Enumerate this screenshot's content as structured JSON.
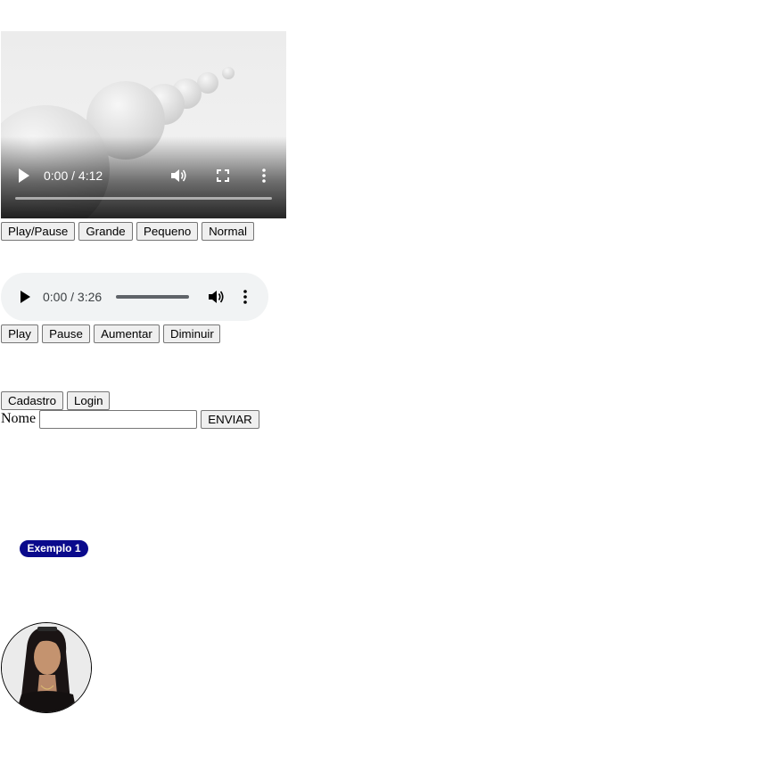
{
  "video": {
    "time": "0:00 / 4:12",
    "icons": [
      "play-icon",
      "volume-icon",
      "fullscreen-icon",
      "more-options-icon"
    ]
  },
  "video_buttons": {
    "play_pause": "Play/Pause",
    "grande": "Grande",
    "pequeno": "Pequeno",
    "normal": "Normal"
  },
  "audio": {
    "time": "0:00 / 3:26",
    "icons": [
      "play-icon",
      "volume-icon",
      "more-options-icon"
    ]
  },
  "audio_buttons": {
    "play": "Play",
    "pause": "Pause",
    "aumentar": "Aumentar",
    "diminuir": "Diminuir"
  },
  "nav_buttons": {
    "cadastro": "Cadastro",
    "login": "Login"
  },
  "form": {
    "label": "Nome",
    "value": "",
    "submit": "ENVIAR"
  },
  "badge": {
    "text": "Exemplo 1",
    "color": "#0a0a8c"
  },
  "colors": {
    "button_bg": "#efefef",
    "audio_bg": "#f1f3f4"
  }
}
